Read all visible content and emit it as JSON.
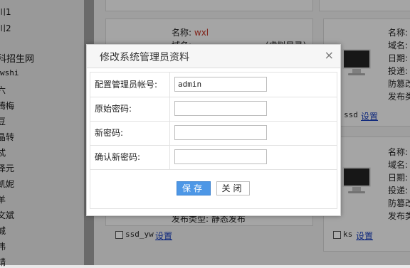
{
  "sidebar": {
    "items": [
      "川1",
      "川2",
      "科招生网",
      "wshi",
      "六",
      "腾梅",
      "豆",
      "晶转",
      "忒",
      "泽元",
      "凯妮",
      "羊",
      "文斌",
      "城",
      "伟",
      "靖"
    ]
  },
  "cards": [
    {
      "name_label": "名称:",
      "name_value": "wxl",
      "domain_label": "域名:",
      "domain_value": "(虚拟目录)",
      "type_label": "发布类型:",
      "type_value": "静态发布",
      "checkbox_label": "ssd_yw",
      "settings_label": "设置"
    },
    {
      "lines": [
        "名称:",
        "域名:",
        "日期:",
        "投递:",
        "防篡改",
        "发布类"
      ],
      "checkbox_label": "ssd",
      "settings_label": "设置"
    },
    {
      "lines": [
        "名称:",
        "域名:",
        "日期:",
        "投递:",
        "防篡改",
        "发布类"
      ],
      "checkbox_label": "ks",
      "settings_label": "设置"
    }
  ],
  "dialog": {
    "title": "修改系统管理员资料",
    "close_glyph": "×",
    "fields": [
      {
        "label": "配置管理员帐号:",
        "value": "admin",
        "placeholder": ""
      },
      {
        "label": "原始密码:",
        "value": "",
        "placeholder": ""
      },
      {
        "label": "新密码:",
        "value": "",
        "placeholder": ""
      },
      {
        "label": "确认新密码:",
        "value": "",
        "placeholder": ""
      }
    ],
    "save_label": "保存",
    "close_label": "关闭"
  },
  "colors": {
    "accent": "#4d97e6",
    "link": "#1a3fb8",
    "value_red": "#c0392b"
  }
}
